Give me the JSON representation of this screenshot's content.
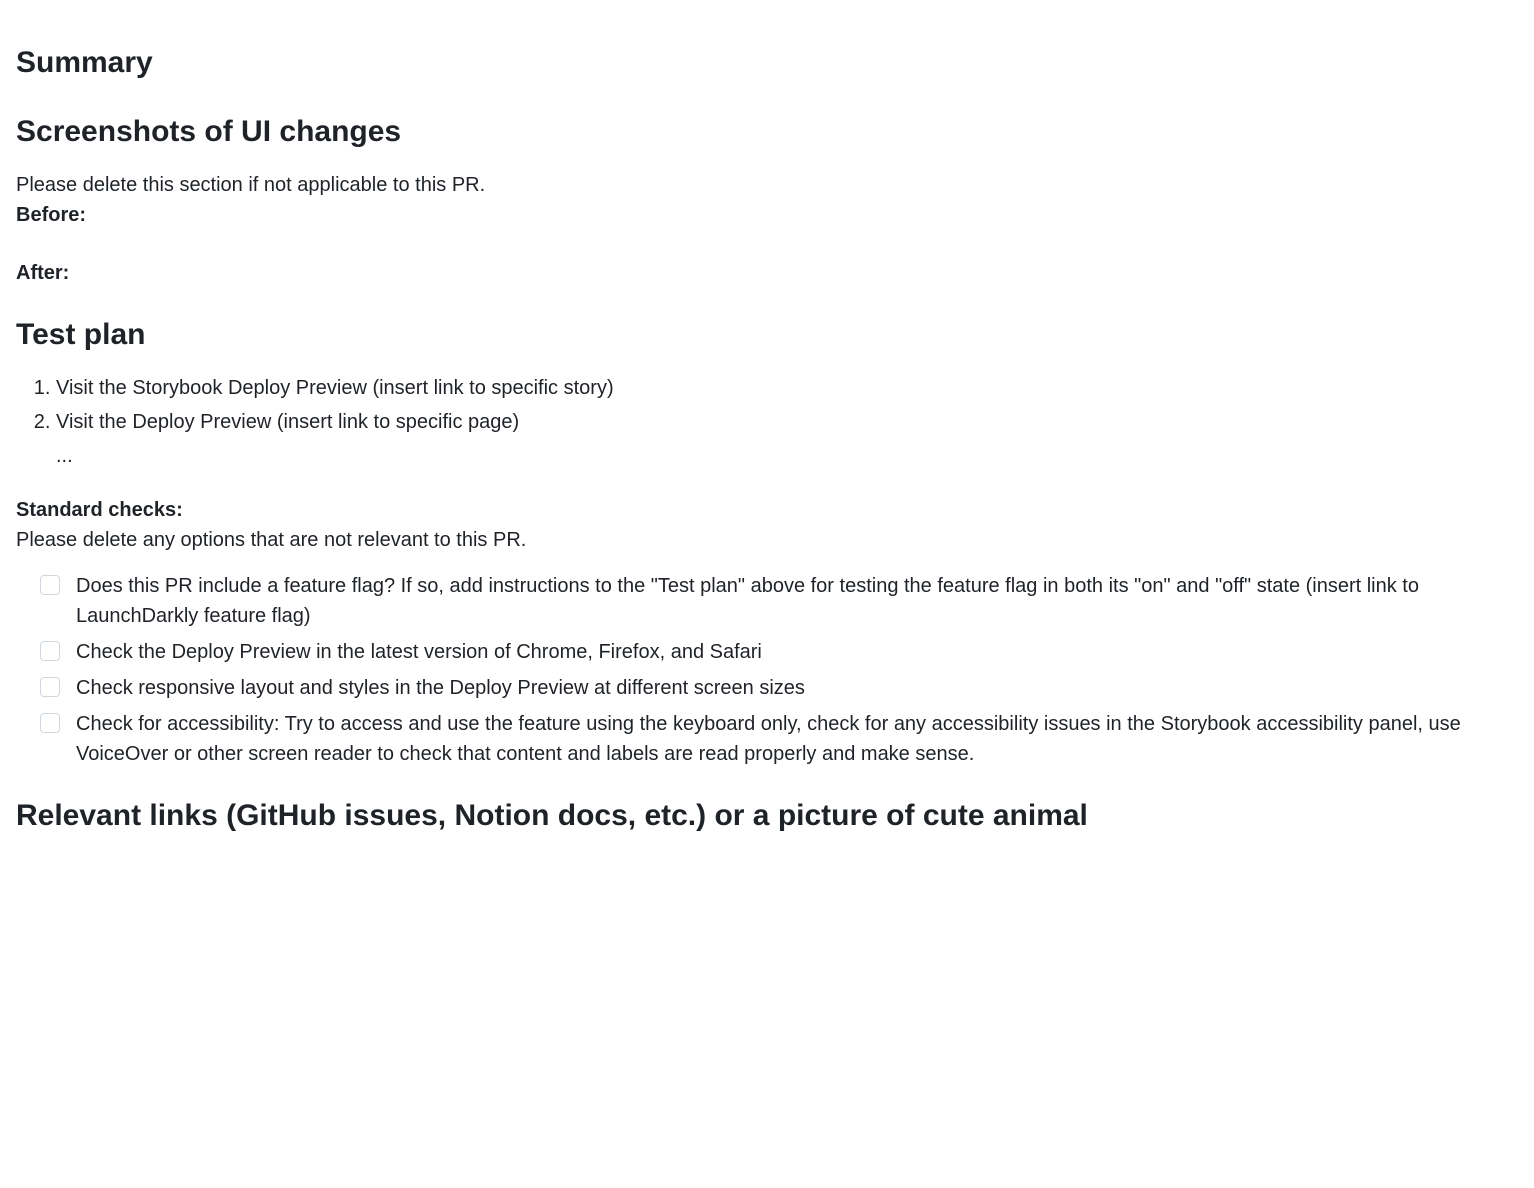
{
  "headings": {
    "summary": "Summary",
    "screenshots": "Screenshots of UI changes",
    "testplan": "Test plan",
    "links": "Relevant links (GitHub issues, Notion docs, etc.) or a picture of cute animal"
  },
  "screenshots": {
    "note": "Please delete this section if not applicable to this PR.",
    "before_label": "Before:",
    "after_label": "After:"
  },
  "testplan": {
    "steps": [
      "Visit the Storybook Deploy Preview (insert link to specific story)",
      "Visit the Deploy Preview (insert link to specific page)"
    ],
    "ellipsis": "..."
  },
  "standard_checks": {
    "heading": "Standard checks:",
    "note": "Please delete any options that are not relevant to this PR.",
    "items": [
      "Does this PR include a feature flag? If so, add instructions to the \"Test plan\" above for testing the feature flag in both its \"on\" and \"off\" state (insert link to LaunchDarkly feature flag)",
      "Check the Deploy Preview in the latest version of Chrome, Firefox, and Safari",
      "Check responsive layout and styles in the Deploy Preview at different screen sizes",
      "Check for accessibility: Try to access and use the feature using the keyboard only, check for any accessibility issues in the Storybook accessibility panel, use VoiceOver or other screen reader to check that content and labels are read properly and make sense."
    ]
  }
}
